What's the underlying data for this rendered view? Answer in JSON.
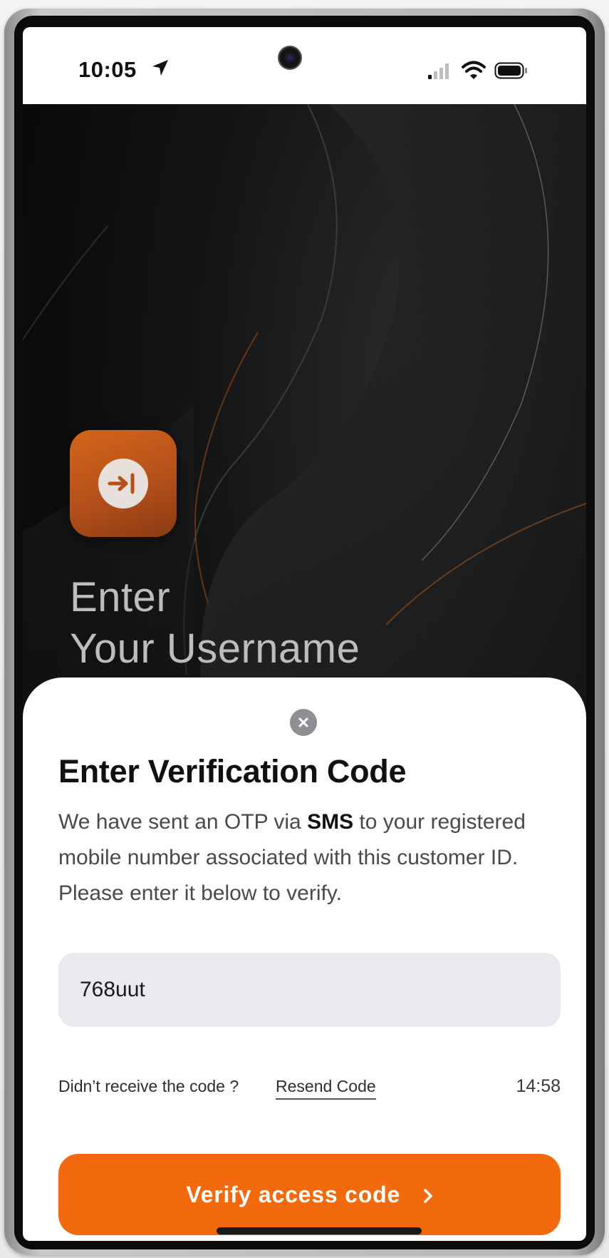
{
  "status_bar": {
    "time": "10:05",
    "icons": [
      "location-arrow-icon",
      "cellular-signal-icon",
      "wifi-icon",
      "battery-icon"
    ]
  },
  "hero": {
    "app_icon": "login-arrow-icon",
    "title_line1": "Enter",
    "title_line2": "Your Username"
  },
  "sheet": {
    "close_icon": "close-icon",
    "title": "Enter Verification Code",
    "desc_before": "We have sent an OTP via ",
    "desc_bold": "SMS",
    "desc_after": " to your registered mobile number associated with this customer ID. Please enter it below to verify.",
    "otp_value": "768uut",
    "resend_question": "Didn’t receive the code ?",
    "resend_link": "Resend Code",
    "timer": "14:58",
    "verify_label": "Verify access code",
    "verify_icon": "chevron-right-icon"
  },
  "colors": {
    "accent": "#f26a0d",
    "icon_orange": "#c45a18",
    "hero_bg": "#0b0b0b",
    "input_bg": "#e9e9ee"
  }
}
